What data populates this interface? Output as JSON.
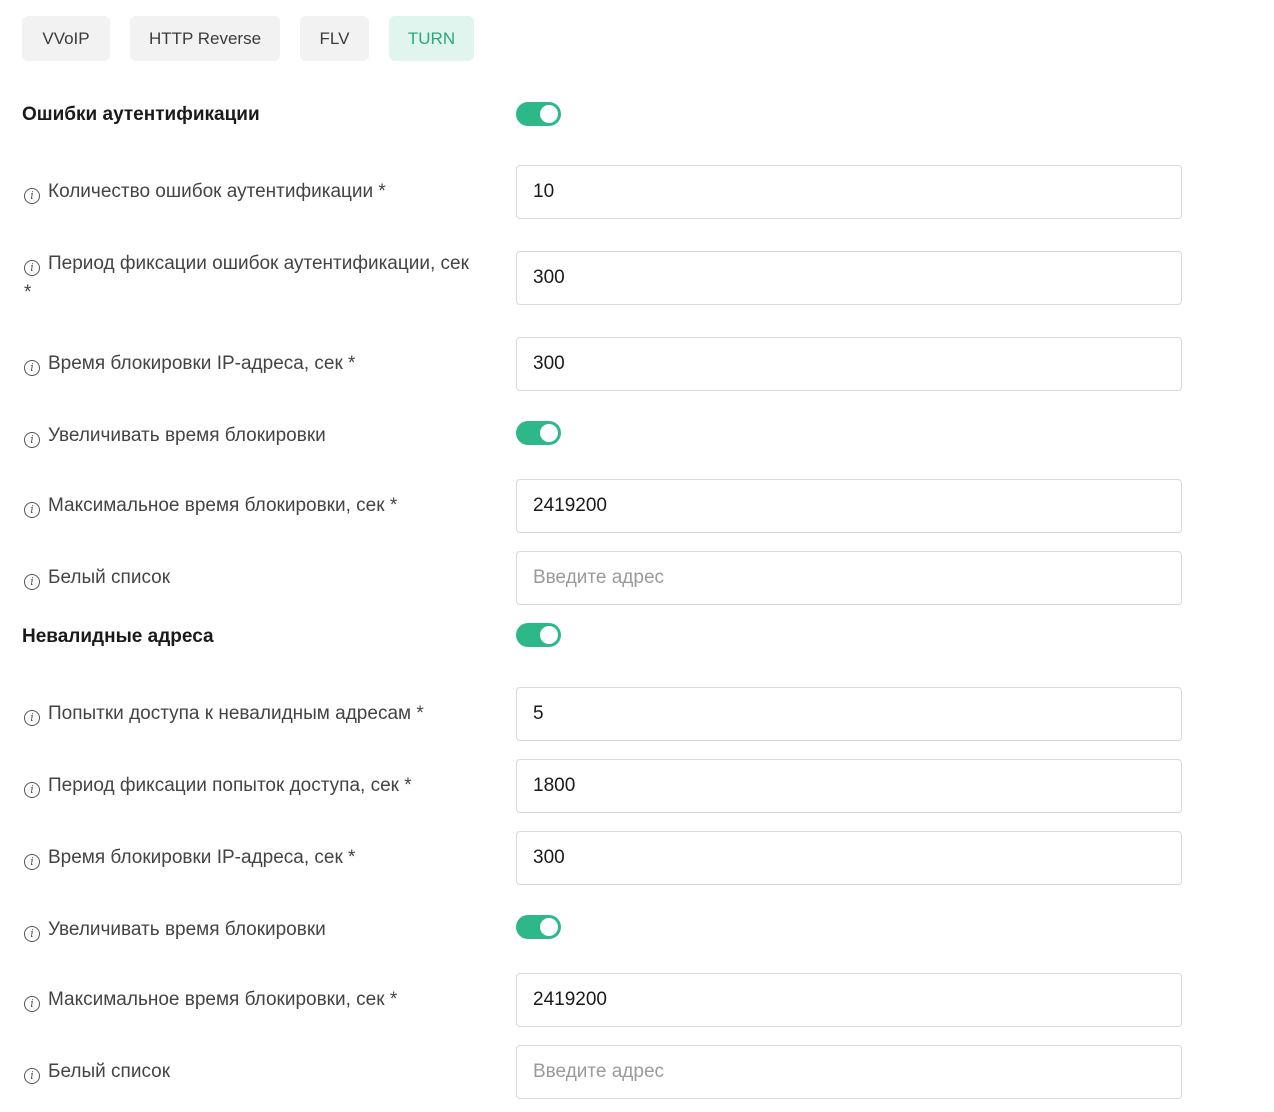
{
  "tabs": [
    {
      "label": "VVoIP",
      "active": false
    },
    {
      "label": "HTTP Reverse",
      "active": false
    },
    {
      "label": "FLV",
      "active": false
    },
    {
      "label": "TURN",
      "active": true
    }
  ],
  "colors": {
    "accent": "#2eb88a",
    "active_tab_bg": "#e0f5ee",
    "active_tab_text": "#2fa57f"
  },
  "auth_errors": {
    "title": "Ошибки аутентификации",
    "enabled": true,
    "error_count": {
      "label": "Количество ошибок аутентификации *",
      "value": "10"
    },
    "error_period": {
      "label": "Период фиксации ошибок аутентификации, сек *",
      "value": "300"
    },
    "block_time": {
      "label": "Время блокировки IP-адреса, сек *",
      "value": "300"
    },
    "increase_block": {
      "label": "Увеличивать время блокировки",
      "enabled": true
    },
    "max_block_time": {
      "label": "Максимальное время блокировки, сек *",
      "value": "2419200"
    },
    "whitelist": {
      "label": "Белый список",
      "value": "",
      "placeholder": "Введите адрес"
    }
  },
  "invalid_addresses": {
    "title": "Невалидные адреса",
    "enabled": true,
    "access_attempts": {
      "label": "Попытки доступа к невалидным адресам *",
      "value": "5"
    },
    "attempt_period": {
      "label": "Период фиксации попыток доступа, сек *",
      "value": "1800"
    },
    "block_time": {
      "label": "Время блокировки IP-адреса, сек *",
      "value": "300"
    },
    "increase_block": {
      "label": "Увеличивать время блокировки",
      "enabled": true
    },
    "max_block_time": {
      "label": "Максимальное время блокировки, сек *",
      "value": "2419200"
    },
    "whitelist": {
      "label": "Белый список",
      "value": "",
      "placeholder": "Введите адрес"
    }
  },
  "icons": {
    "info": "info-icon",
    "info_glyph": "i"
  }
}
